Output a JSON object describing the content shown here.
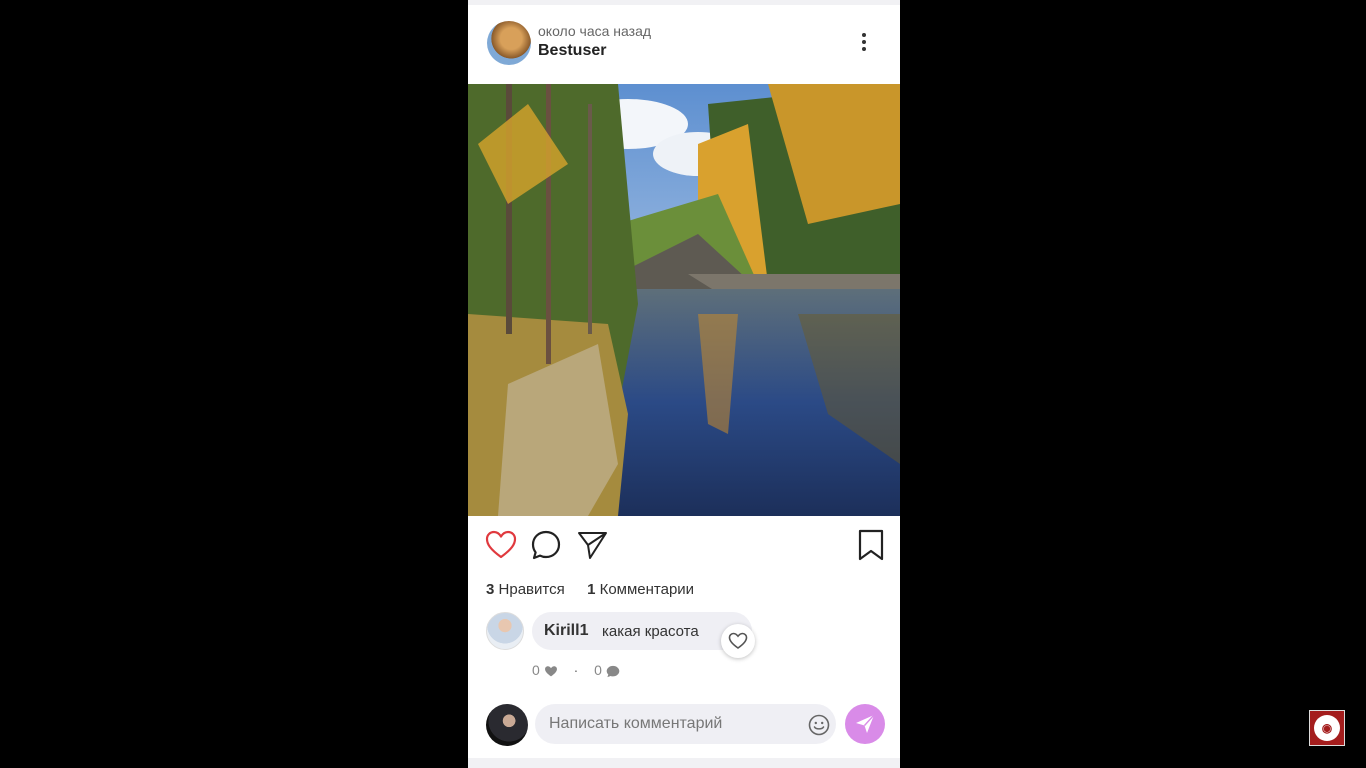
{
  "post": {
    "time_ago": "около часа назад",
    "username": "Bestuser",
    "likes_count": "3",
    "likes_label": "Нравится",
    "comments_count": "1",
    "comments_label": "Комментарии"
  },
  "comment": {
    "author": "Kirill1",
    "text": "какая красота",
    "likes": "0",
    "replies": "0"
  },
  "composer": {
    "placeholder": "Написать комментарий"
  },
  "colors": {
    "background": "#000000",
    "like_heart": "#e0393e",
    "send_button": "#d98be8",
    "input_bg": "#efeff4",
    "badge": "#a41d1d"
  },
  "icons": [
    "more-vert-icon",
    "heart-outline-icon",
    "comment-bubble-icon",
    "send-paper-plane-icon",
    "bookmark-icon",
    "heart-small-icon",
    "chat-small-icon",
    "emoji-smile-icon",
    "send-arrow-icon",
    "channel-logo"
  ]
}
